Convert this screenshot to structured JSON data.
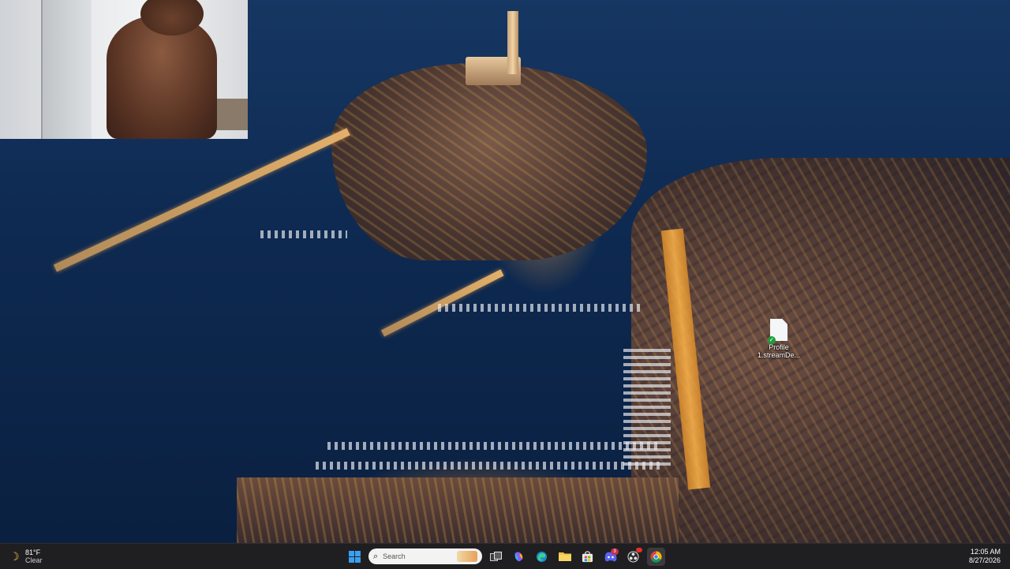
{
  "desktop": {
    "icons": [
      {
        "label": "Profile 1.streamDe..."
      }
    ]
  },
  "webcam": {
    "description_name": "webcam-overlay"
  },
  "taskbar": {
    "weather": {
      "temp": "81°F",
      "condition": "Clear",
      "icon": "moon-icon"
    },
    "search": {
      "placeholder": "Search"
    },
    "apps": [
      {
        "name": "start-button",
        "icon": "windows-logo-icon"
      },
      {
        "name": "task-view",
        "icon": "task-view-icon"
      },
      {
        "name": "copilot",
        "icon": "copilot-icon"
      },
      {
        "name": "edge",
        "icon": "edge-icon"
      },
      {
        "name": "file-explorer",
        "icon": "folder-icon"
      },
      {
        "name": "microsoft-store",
        "icon": "store-icon"
      },
      {
        "name": "discord",
        "icon": "discord-icon",
        "badge": "3"
      },
      {
        "name": "obs",
        "icon": "obs-icon"
      },
      {
        "name": "chrome",
        "icon": "chrome-icon"
      }
    ],
    "clock": {
      "time": "12:05 AM",
      "date": "8/27/2026"
    }
  },
  "colors": {
    "taskbar_bg": "#1f1f22",
    "accent_windows": "#3aa0f3",
    "weather_moon": "#f3c24a"
  }
}
